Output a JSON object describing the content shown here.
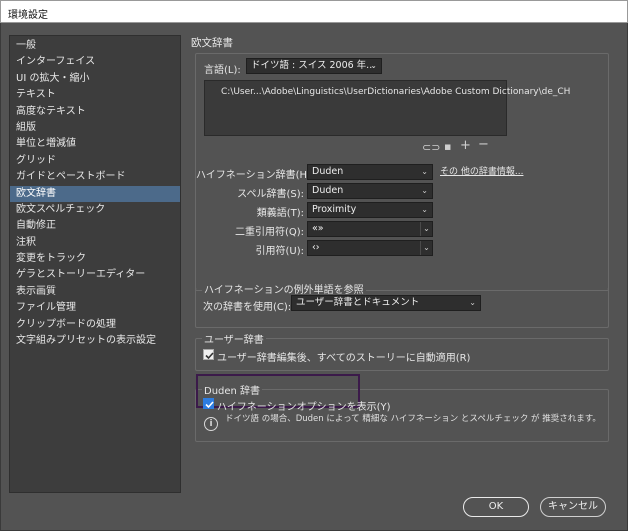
{
  "window": {
    "title": "環境設定"
  },
  "sidebar": {
    "items": [
      {
        "label": "一般"
      },
      {
        "label": "インターフェイス"
      },
      {
        "label": "UI の拡大・縮小"
      },
      {
        "label": "テキスト"
      },
      {
        "label": "高度なテキスト"
      },
      {
        "label": "組版"
      },
      {
        "label": "単位と増減値"
      },
      {
        "label": "グリッド"
      },
      {
        "label": "ガイドとペーストボード"
      },
      {
        "label": "欧文辞書",
        "selected": true
      },
      {
        "label": "欧文スペルチェック"
      },
      {
        "label": "自動修正"
      },
      {
        "label": "注釈"
      },
      {
        "label": "変更をトラック"
      },
      {
        "label": "ゲラとストーリーエディター"
      },
      {
        "label": "表示画質"
      },
      {
        "label": "ファイル管理"
      },
      {
        "label": "クリップボードの処理"
      },
      {
        "label": "文字組みプリセットの表示設定"
      }
    ]
  },
  "main": {
    "title": "欧文辞書"
  },
  "language": {
    "label": "言語(L):",
    "value": "ドイツ語 : スイス 2006 年...",
    "dictionary_path": "C:\\User...\\Adobe\\Linguistics\\UserDictionaries\\Adobe Custom Dictionary\\de_CH",
    "fields": [
      {
        "label": "ハイフネーション辞書(H):",
        "value": "Duden"
      },
      {
        "label": "スペル辞書(S):",
        "value": "Duden"
      },
      {
        "label": "類義語(T):",
        "value": "Proximity"
      },
      {
        "label": "二重引用符(Q):",
        "value": "«»"
      },
      {
        "label": "引用符(U):",
        "value": "‹›"
      }
    ],
    "other_dict_link": "その 他の辞書情報..."
  },
  "hyphenation_exceptions": {
    "title": "ハイフネーションの例外単語を参照",
    "label": "次の辞書を使用(C):",
    "value": "ユーザー辞書とドキュメント"
  },
  "user_dictionary": {
    "title": "ユーザー辞書",
    "checkbox_label": "ユーザー辞書編集後、すべてのストーリーに自動適用(R)",
    "checked": true
  },
  "duden": {
    "title": "Duden 辞書",
    "checkbox_label": "ハイフネーションオプションを表示(Y)",
    "checked": true,
    "note": "ドイツ語 の場合、Duden によって 精細な ハイフネーション とスペルチェック が 推奨されます。"
  },
  "buttons": {
    "ok": "OK",
    "cancel": "キャンセル"
  }
}
